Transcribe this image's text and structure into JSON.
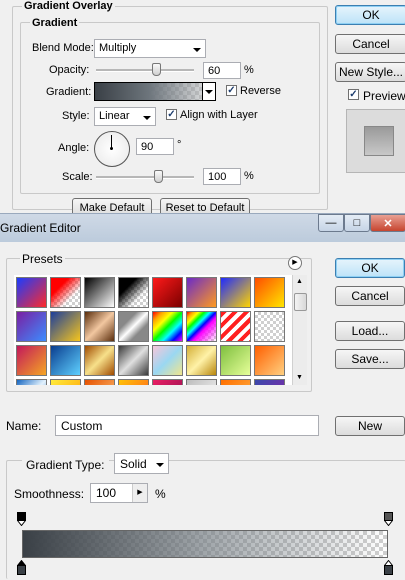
{
  "layer_style": {
    "section": "Gradient Overlay",
    "group": "Gradient",
    "blend_mode_label": "Blend Mode:",
    "blend_mode": "Multiply",
    "opacity_label": "Opacity:",
    "opacity_value": "60",
    "opacity_unit": "%",
    "opacity_level": 60,
    "gradient_label": "Gradient:",
    "reverse_label": "Reverse",
    "reverse_checked": true,
    "style_label": "Style:",
    "style_value": "Linear",
    "align_label": "Align with Layer",
    "align_checked": true,
    "angle_label": "Angle:",
    "angle_value": "90",
    "angle_unit": "°",
    "scale_label": "Scale:",
    "scale_value": "100",
    "scale_unit": "%",
    "make_default": "Make Default",
    "reset_default": "Reset to Default",
    "ok": "OK",
    "cancel": "Cancel",
    "new_style": "New Style...",
    "preview_label": "Preview",
    "preview_checked": true
  },
  "gradient_editor": {
    "title": "Gradient Editor",
    "presets_label": "Presets",
    "ok": "OK",
    "cancel": "Cancel",
    "load": "Load...",
    "save": "Save...",
    "name_label": "Name:",
    "name_value": "Custom",
    "new_button": "New",
    "type_label": "Gradient Type:",
    "type_value": "Solid",
    "smoothness_label": "Smoothness:",
    "smoothness_value": "100",
    "smoothness_unit": "%",
    "min_glyph": "—",
    "max_glyph": "□",
    "close_glyph": "✕",
    "flyout_glyph": "▶"
  },
  "colors": {
    "accent": "#3c7fb1",
    "title_bar": "#c6d3e3"
  }
}
